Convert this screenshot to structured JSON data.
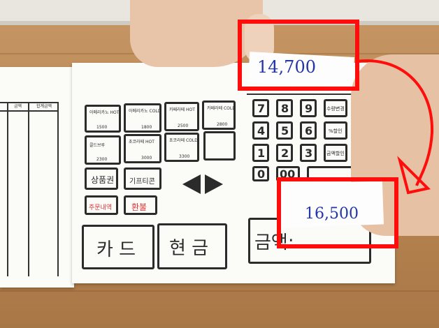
{
  "register": {
    "menu_items": [
      {
        "name": "아메리카노 HOT",
        "price": "1500"
      },
      {
        "name": "아메리카노 COLD",
        "price": "1800"
      },
      {
        "name": "카페라떼 HOT",
        "price": "2500"
      },
      {
        "name": "카페라떼 COLD",
        "price": "2800"
      },
      {
        "name": "콜드브루",
        "price": "2300"
      },
      {
        "name": "초코라떼 HOT",
        "price": "3000"
      },
      {
        "name": "초코라떼 COLD",
        "price": "3300"
      }
    ],
    "buttons": {
      "product_voucher": "상품권",
      "gifticon": "기프티콘",
      "order_history": "주문내역",
      "refund": "환불",
      "card": "카 드",
      "cash": "현 금"
    },
    "keypad": {
      "keys": [
        "7",
        "8",
        "9",
        "4",
        "5",
        "6",
        "1",
        "2",
        "3",
        "0",
        "00"
      ],
      "side_labels": [
        "수량변경",
        "%할인",
        "금액할인"
      ],
      "plus": "+",
      "minus": "−"
    },
    "top_total": "14,700",
    "amount_label": "금액:",
    "amount_value": "16,500",
    "left_sheet_headers": [
      "금액",
      "합계금액"
    ],
    "accent_red": "#ff0d0d",
    "ink_blue": "#2336a8"
  }
}
